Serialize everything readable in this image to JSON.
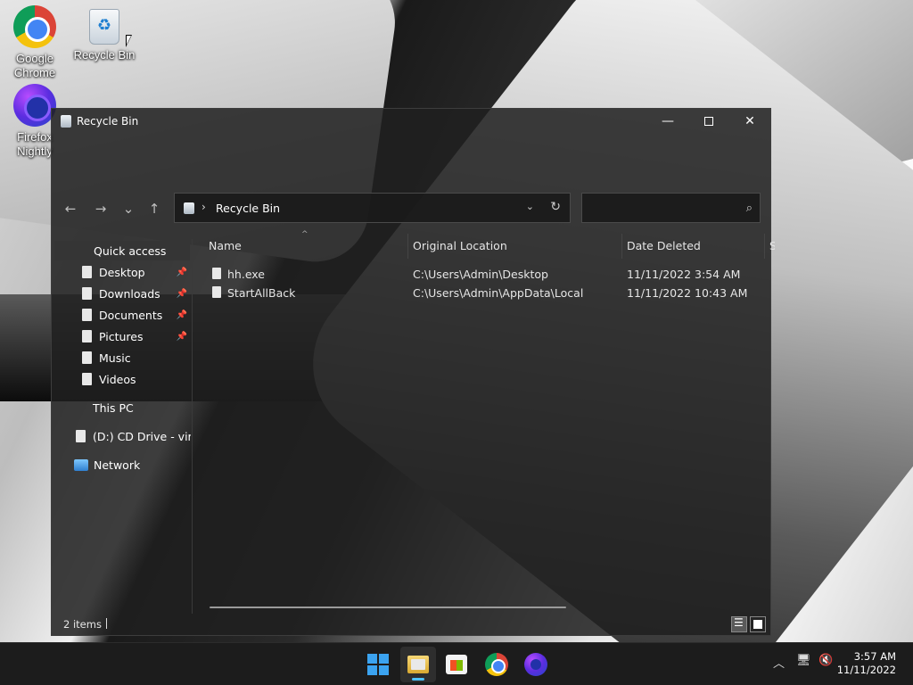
{
  "desktop": {
    "icons": [
      {
        "label_line1": "Google",
        "label_line2": "Chrome",
        "icon": "chrome-icon"
      },
      {
        "label_line1": "Recycle Bin",
        "label_line2": "",
        "icon": "recycle-bin-icon"
      },
      {
        "label_line1": "Firefox",
        "label_line2": "Nightly",
        "icon": "firefox-nightly-icon"
      }
    ]
  },
  "window": {
    "title": "Recycle Bin",
    "controls": {
      "minimize": "—",
      "close": "✕"
    },
    "nav": {
      "back": "←",
      "forward": "→",
      "recent": "⌄",
      "up": "↑"
    },
    "address": {
      "separator": "›",
      "path": "Recycle Bin",
      "dropdown": "⌄",
      "refresh": "↻"
    },
    "search": {
      "placeholder": "",
      "icon": "⌕"
    },
    "sidebar": {
      "quick_access": "Quick access",
      "items": [
        {
          "label": "Desktop",
          "pinned": true
        },
        {
          "label": "Downloads",
          "pinned": true
        },
        {
          "label": "Documents",
          "pinned": true
        },
        {
          "label": "Pictures",
          "pinned": true
        },
        {
          "label": "Music",
          "pinned": false
        },
        {
          "label": "Videos",
          "pinned": false
        }
      ],
      "pin_glyph": "📌",
      "this_pc": "This PC",
      "cd_drive": "(D:) CD Drive - virti",
      "network": "Network"
    },
    "columns": [
      "Name",
      "Original Location",
      "Date Deleted",
      "S"
    ],
    "sort_caret": "^",
    "rows": [
      {
        "name": "hh.exe",
        "location": "C:\\Users\\Admin\\Desktop",
        "date": "11/11/2022 3:54 AM"
      },
      {
        "name": "StartAllBack",
        "location": "C:\\Users\\Admin\\AppData\\Local",
        "date": "11/11/2022 10:43 AM"
      }
    ],
    "status": {
      "items": "2 items"
    }
  },
  "taskbar": {
    "apps": [
      "start-button",
      "file-explorer",
      "microsoft-store",
      "google-chrome",
      "firefox-nightly"
    ],
    "tray": {
      "chevron": "︿",
      "network": "🖥",
      "volume": "🔇"
    },
    "clock": {
      "time": "3:57 AM",
      "date": "11/11/2022"
    }
  },
  "colors": {
    "accent": "#4cc2ff",
    "window_bg": "#202020",
    "taskbar_bg": "#1c1c1c"
  }
}
